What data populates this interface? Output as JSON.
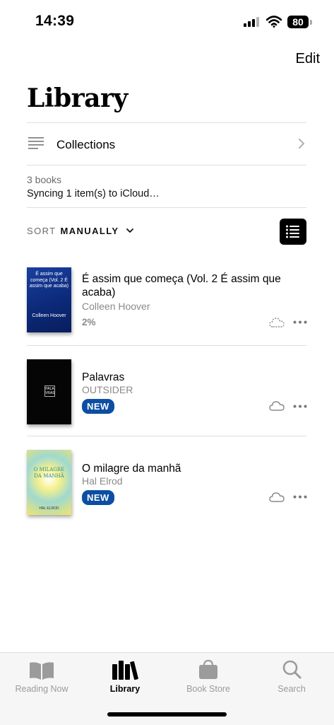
{
  "status_bar": {
    "time": "14:39",
    "battery": "80"
  },
  "header": {
    "edit_label": "Edit",
    "title": "Library"
  },
  "collections": {
    "label": "Collections"
  },
  "summary": {
    "count": "3 books",
    "sync": "Syncing 1 item(s) to iCloud…"
  },
  "sort": {
    "label": "SORT",
    "value": "MANUALLY"
  },
  "books": [
    {
      "title": "É assim que começa (Vol. 2 É assim que acaba)",
      "author": "Colleen Hoover",
      "progress": "2%",
      "cover_title": "É assim que começa (Vol. 2 É assim que acaba)",
      "cover_author": "Colleen Hoover"
    },
    {
      "title": "Palavras",
      "author": "OUTSIDER",
      "badge": "NEW",
      "cover_title": "PALA VRAS"
    },
    {
      "title": "O milagre da manhã",
      "author": "Hal Elrod",
      "badge": "NEW",
      "cover_title": "O MILAGRE DA MANHÃ",
      "cover_author": "HAL ELROD"
    }
  ],
  "tabs": [
    {
      "label": "Reading Now",
      "icon": "book-open-icon"
    },
    {
      "label": "Library",
      "icon": "books-stack-icon",
      "active": true
    },
    {
      "label": "Book Store",
      "icon": "bag-icon"
    },
    {
      "label": "Search",
      "icon": "search-icon"
    }
  ],
  "colors": {
    "badge": "#0c4ea2",
    "active_tab": "#000000",
    "inactive_tab": "#9b9b9b"
  }
}
